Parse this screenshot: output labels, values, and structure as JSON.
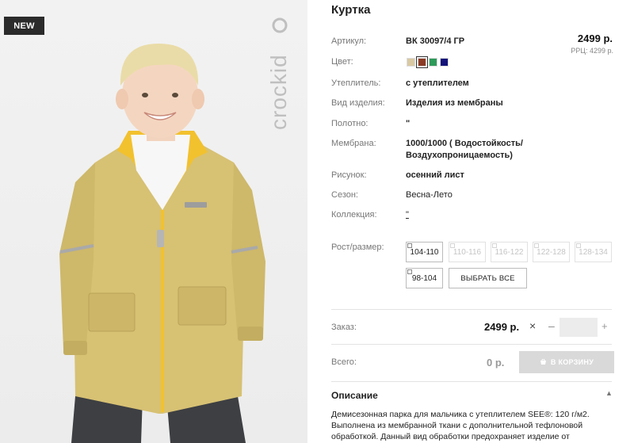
{
  "product": {
    "badge": "NEW",
    "brand": "crockid",
    "title": "Куртка",
    "price": "2499 р.",
    "rrc": "РРЦ: 4299 р.",
    "specs": [
      {
        "label": "Артикул:",
        "value": "ВК 30097/4 ГР"
      },
      {
        "label": "Цвет:",
        "value": ""
      },
      {
        "label": "Утеплитель:",
        "value": "с утеплителем"
      },
      {
        "label": "Вид изделия:",
        "value": "Изделия из мембраны"
      },
      {
        "label": "Полотно:",
        "value": "\""
      },
      {
        "label": "Мембрана:",
        "value": "1000/1000 ( Водостойкость/ Воздухопроницаемость)"
      },
      {
        "label": "Рисунок:",
        "value": "осенний лист"
      },
      {
        "label": "Сезон:",
        "value": "Весна-Лето"
      },
      {
        "label": "Коллекция:",
        "value": "\""
      }
    ],
    "colors": [
      {
        "name": "beige",
        "hex": "#d9c9a3",
        "selected": false
      },
      {
        "name": "brown",
        "hex": "#8b3a24",
        "selected": true
      },
      {
        "name": "green",
        "hex": "#2e9a5a",
        "selected": false
      },
      {
        "name": "navy",
        "hex": "#14147a",
        "selected": false
      }
    ],
    "sizes_label": "Рост/размер:",
    "sizes": [
      {
        "label": "104-110",
        "available": true
      },
      {
        "label": "110-116",
        "available": false
      },
      {
        "label": "116-122",
        "available": false
      },
      {
        "label": "122-128",
        "available": false
      },
      {
        "label": "128-134",
        "available": false
      },
      {
        "label": "98-104",
        "available": true
      }
    ],
    "select_all": "ВЫБРАТЬ ВСЕ"
  },
  "order": {
    "label": "Заказ:",
    "price": "2499 р.",
    "remove": "×",
    "minus": "–",
    "plus": "+",
    "quantity": ""
  },
  "total": {
    "label": "Всего:",
    "value": "0 р.",
    "cart_button": "В КОРЗИНУ"
  },
  "description": {
    "title": "Описание",
    "toggle": "▲",
    "text": "Демисезонная парка для мальчика с утеплителем SEE®: 120 г/м2. Выполнена из мембранной ткани с дополнительной тефлоновой обработкой. Данный вид обработки предохраняет изделие от"
  },
  "colors_theme": {
    "badge_bg": "#2b2b2b",
    "jacket": "#d7c173",
    "zipper": "#f2c12e",
    "cart_button_bg": "#d9d9d9"
  }
}
